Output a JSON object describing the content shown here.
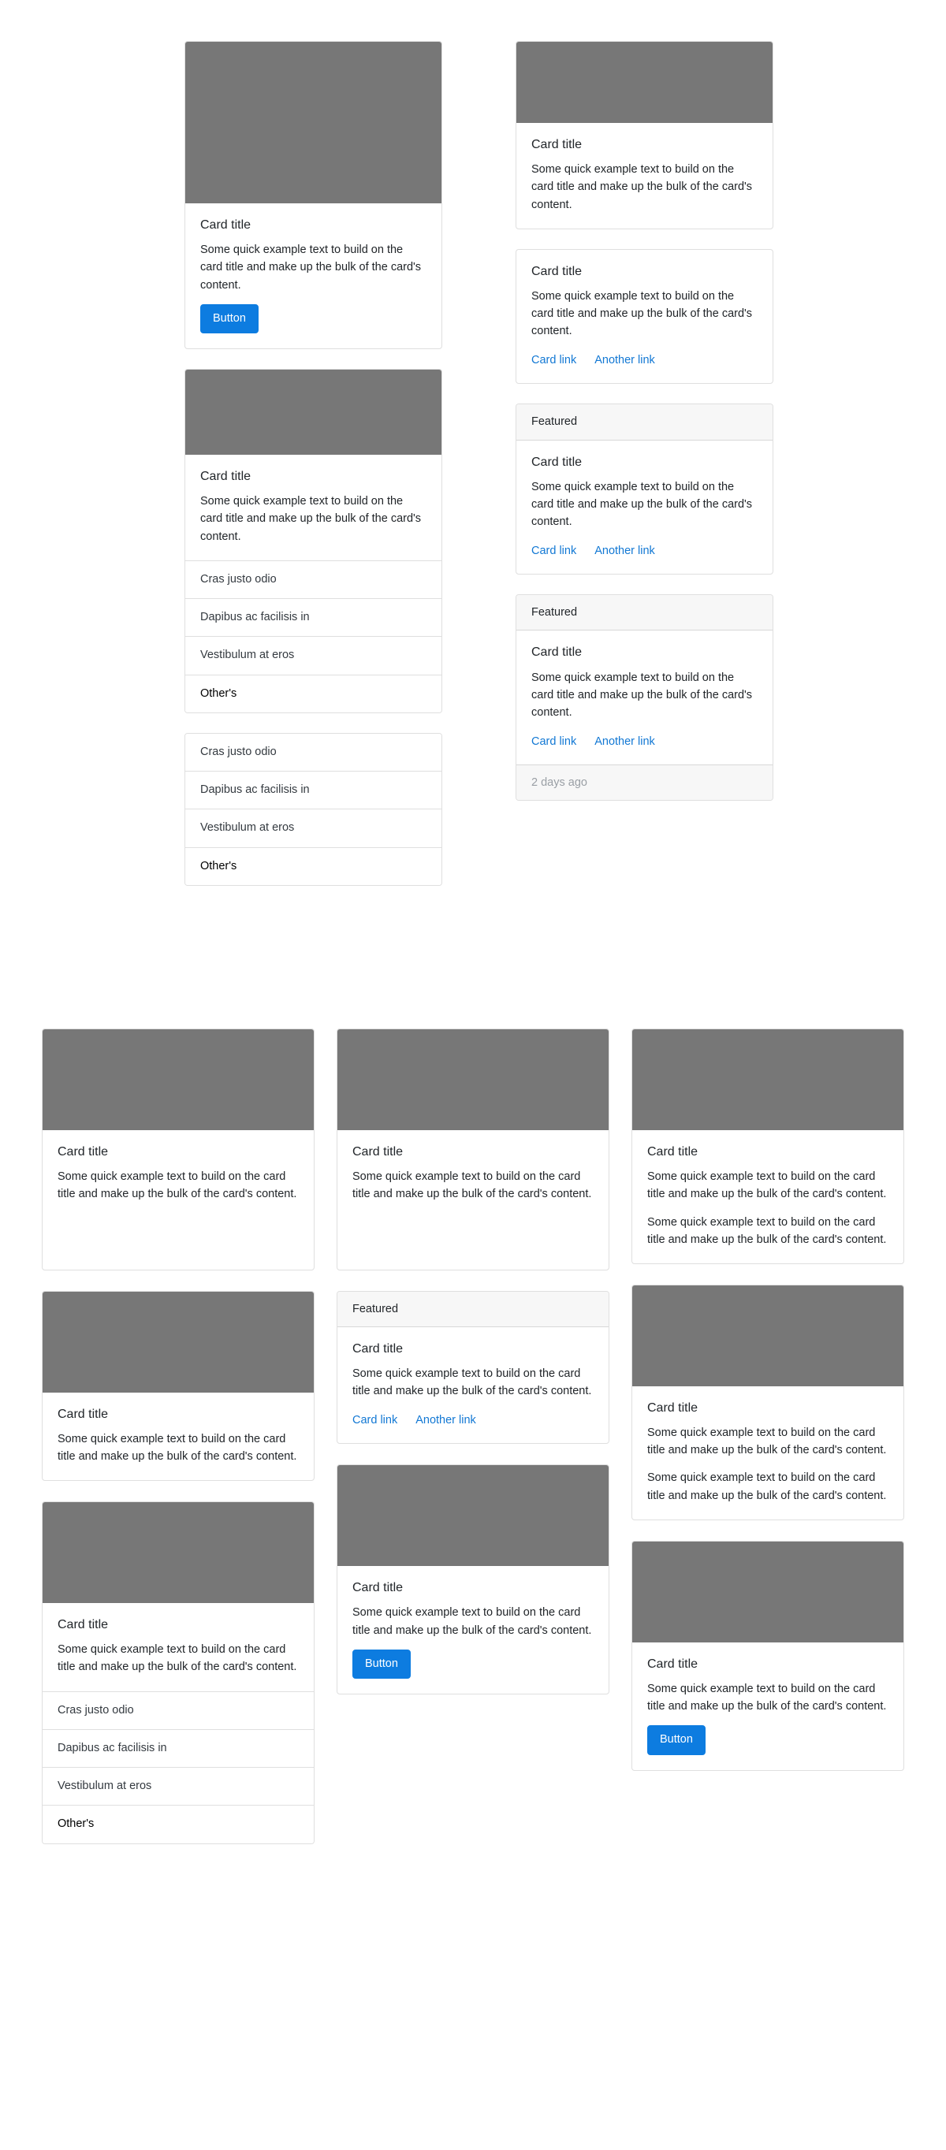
{
  "strings": {
    "card_title": "Card title",
    "card_text": "Some quick example text to build on the card title and make up the bulk of the card's content.",
    "button_label": "Button",
    "card_link": "Card link",
    "another_link": "Another link",
    "header_featured": "Featured",
    "footer_days": "2 days ago",
    "list_1": "Cras justo odio",
    "list_2": "Dapibus ac facilisis in",
    "list_3": "Vestibulum at eros",
    "list_4": "Other's"
  },
  "colors": {
    "image_placeholder": "#777777",
    "primary_button": "#0d7ce0",
    "link": "#1278d4",
    "card_border": "#dcdcdc",
    "header_bg": "#f7f7f7",
    "muted_text": "#9a9fa5"
  },
  "top_section": {
    "columns": [
      {
        "cards": [
          {
            "name": "card-image-body-button",
            "has_image": true,
            "title": "Card title",
            "texts": [
              "Some quick example text to build on the card title and make up the bulk of the card's content."
            ],
            "button": "Button"
          },
          {
            "name": "card-image-body-listgroup",
            "has_image": true,
            "title": "Card title",
            "texts": [
              "Some quick example text to build on the card title and make up the bulk of the card's content."
            ],
            "list": [
              "Cras justo odio",
              "Dapibus ac facilisis in",
              "Vestibulum at eros",
              "Other's"
            ]
          },
          {
            "name": "card-listgroup-only",
            "has_image": false,
            "list": [
              "Cras justo odio",
              "Dapibus ac facilisis in",
              "Vestibulum at eros",
              "Other's"
            ]
          }
        ]
      },
      {
        "cards": [
          {
            "name": "card-image-body",
            "has_image": true,
            "title": "Card title",
            "texts": [
              "Some quick example text to build on the card title and make up the bulk of the card's content."
            ]
          },
          {
            "name": "card-body-links",
            "has_image": false,
            "title": "Card title",
            "texts": [
              "Some quick example text to build on the card title and make up the bulk of the card's content."
            ],
            "links": [
              "Card link",
              "Another link"
            ]
          },
          {
            "name": "card-header-body-links",
            "has_image": false,
            "header": "Featured",
            "title": "Card title",
            "texts": [
              "Some quick example text to build on the card title and make up the bulk of the card's content."
            ],
            "links": [
              "Card link",
              "Another link"
            ]
          },
          {
            "name": "card-header-body-links-footer",
            "has_image": false,
            "header": "Featured",
            "title": "Card title",
            "texts": [
              "Some quick example text to build on the card title and make up the bulk of the card's content."
            ],
            "links": [
              "Card link",
              "Another link"
            ],
            "footer": "2 days ago"
          }
        ]
      }
    ]
  },
  "bottom_section": {
    "columns": [
      {
        "cards": [
          {
            "name": "grid-card-image-text",
            "has_image": true,
            "title": "Card title",
            "texts": [
              "Some quick example text to build on the card title and make up the bulk of the card's content."
            ]
          },
          {
            "name": "grid-card-image-text-2",
            "has_image": true,
            "title": "Card title",
            "texts": [
              "Some quick example text to build on the card title and make up the bulk of the card's content."
            ]
          },
          {
            "name": "grid-card-image-text-listgroup",
            "has_image": true,
            "title": "Card title",
            "texts": [
              "Some quick example text to build on the card title and make up the bulk of the card's content."
            ],
            "list": [
              "Cras justo odio",
              "Dapibus ac facilisis in",
              "Vestibulum at eros",
              "Other's"
            ]
          }
        ]
      },
      {
        "cards": [
          {
            "name": "grid-card-image-text-3",
            "has_image": true,
            "title": "Card title",
            "texts": [
              "Some quick example text to build on the card title and make up the bulk of the card's content."
            ]
          },
          {
            "name": "grid-card-header-links",
            "has_image": false,
            "header": "Featured",
            "title": "Card title",
            "texts": [
              "Some quick example text to build on the card title and make up the bulk of the card's content."
            ],
            "links": [
              "Card link",
              "Another link"
            ]
          },
          {
            "name": "grid-card-image-button",
            "has_image": true,
            "title": "Card title",
            "texts": [
              "Some quick example text to build on the card title and make up the bulk of the card's content."
            ],
            "button": "Button"
          }
        ]
      },
      {
        "cards": [
          {
            "name": "grid-card-image-two-paragraphs",
            "has_image": true,
            "title": "Card title",
            "texts": [
              "Some quick example text to build on the card title and make up the bulk of the card's content.",
              "Some quick example text to build on the card title and make up the bulk of the card's content."
            ]
          },
          {
            "name": "grid-card-image-two-paragraphs-2",
            "has_image": true,
            "title": "Card title",
            "texts": [
              "Some quick example text to build on the card title and make up the bulk of the card's content.",
              "Some quick example text to build on the card title and make up the bulk of the card's content."
            ]
          },
          {
            "name": "grid-card-image-button-2",
            "has_image": true,
            "title": "Card title",
            "texts": [
              "Some quick example text to build on the card title and make up the bulk of the card's content."
            ],
            "button": "Button"
          }
        ]
      }
    ]
  }
}
